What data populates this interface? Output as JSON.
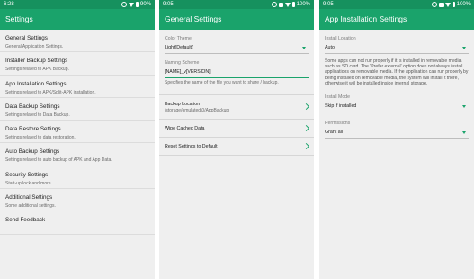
{
  "panel1": {
    "status": {
      "time": "6:28",
      "battery": "90%"
    },
    "title": "Settings",
    "items": [
      {
        "title": "General Settings",
        "subtitle": "General Application Settings."
      },
      {
        "title": "Installer Backup Settings",
        "subtitle": "Settings related to APK Backup."
      },
      {
        "title": "App Installation Settings",
        "subtitle": "Settings related to APK/Split-APK installation."
      },
      {
        "title": "Data Backup Settings",
        "subtitle": "Settings related to Data Backup."
      },
      {
        "title": "Data Restore Settings",
        "subtitle": "Settings related to data restoration."
      },
      {
        "title": "Auto Backup Settings",
        "subtitle": "Settings related to auto backup of APK and App Data."
      },
      {
        "title": "Security Settings",
        "subtitle": "Start-up lock and more."
      },
      {
        "title": "Additional Settings",
        "subtitle": "Some additional settings."
      },
      {
        "title": "Send Feedback",
        "subtitle": ""
      }
    ]
  },
  "panel2": {
    "status": {
      "time": "9:05",
      "battery": "100%"
    },
    "title": "General Settings",
    "color_theme_label": "Color Theme",
    "color_theme_value": "Light(Default)",
    "naming_scheme_label": "Naming Scheme",
    "naming_scheme_value": "[NAME]_v[VERSION]",
    "naming_scheme_helper": "Specifies the name of the file you want to share / backup.",
    "backup_location_title": "Backup Location",
    "backup_location_value": "/storage/emulated/0/AppBackup",
    "wipe_cache_label": "Wipe Cached Data",
    "reset_label": "Reset Settings to Default"
  },
  "panel3": {
    "status": {
      "time": "9:05",
      "battery": "100%"
    },
    "title": "App Installation Settings",
    "install_location_label": "Install Location",
    "install_location_value": "Auto",
    "install_location_note": "Some apps can not run properly if it is installed in removable media such as SD card. The 'Prefer external' option does not always install applications on removable media. If the application can run properly by being installed on removable media, the system will install it there, otherwise it will be installed inside internal storage.",
    "install_mode_label": "Install Mode",
    "install_mode_value": "Skip if installed",
    "permissions_label": "Permissions",
    "permissions_value": "Grant all"
  }
}
